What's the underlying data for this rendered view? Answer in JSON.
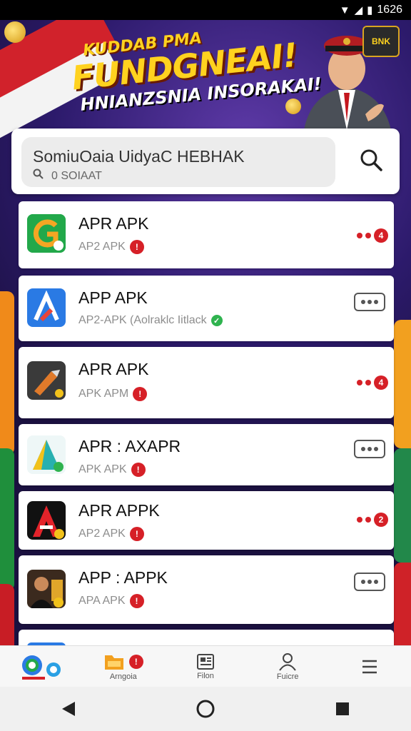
{
  "status_bar": {
    "time": "1626"
  },
  "banner": {
    "line1": "KUDDAB PMA",
    "line2": "FUNDGNEAI!",
    "line3": "HNIANZSNIA INSORAKAI!",
    "badge": "BNK"
  },
  "search": {
    "title": "SomiuOaia UidyaC HEBHAK",
    "subtitle": "0 SOIAAT",
    "search_icon": "magnifier-icon"
  },
  "apps": [
    {
      "name": "APR APK",
      "sub": "AP2 APK",
      "sub_badge": "!",
      "action": "dots",
      "action_count": "4",
      "icon_color": "#22a84a",
      "icon_letter": "G"
    },
    {
      "name": "APP APK",
      "sub": "AP2-APK (Aolraklc Iitlack",
      "sub_badge": "✓",
      "action": "more",
      "icon_color": "#2a7ae4",
      "icon_letter": "A"
    },
    {
      "name": "APR APK",
      "sub": "APK APM",
      "sub_badge": "!",
      "action": "dots",
      "action_count": "4",
      "icon_color": "#3a3a3a",
      "icon_letter": ""
    },
    {
      "name": "APR : AXAPR",
      "sub": "APK APK",
      "sub_badge": "!",
      "action": "more",
      "icon_color": "#28b0b0",
      "icon_letter": "A"
    },
    {
      "name": "APR APPK",
      "sub": "AP2 APK",
      "sub_badge": "!",
      "action": "dots",
      "action_count": "2",
      "icon_color": "#111111",
      "icon_letter": "A"
    },
    {
      "name": "APP : APPK",
      "sub": "APA APK",
      "sub_badge": "!",
      "action": "more",
      "icon_color": "#3b2a1e",
      "icon_letter": ""
    }
  ],
  "bottom_nav": [
    {
      "label": "",
      "icon": "app-logo-icon"
    },
    {
      "label": "Arngoia",
      "icon": "folder-icon",
      "badge": "!"
    },
    {
      "label": "Filon",
      "icon": "news-icon"
    },
    {
      "label": "Fuicre",
      "icon": "person-icon"
    },
    {
      "label": "",
      "icon": "menu-icon"
    }
  ],
  "system_nav": [
    "back",
    "home",
    "recents"
  ]
}
